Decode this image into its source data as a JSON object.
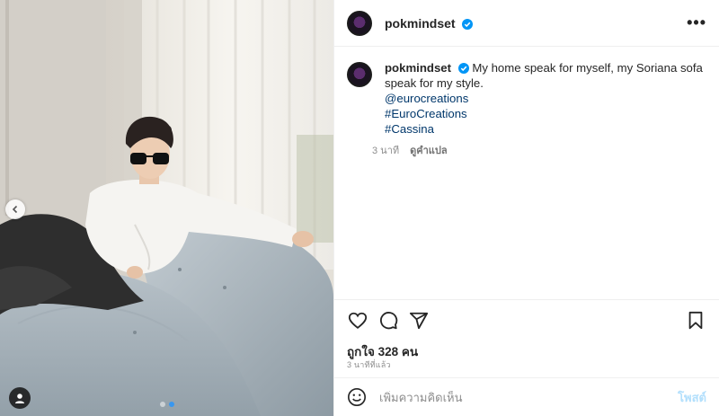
{
  "post": {
    "username": "pokmindset",
    "verified": true,
    "more_label": "•••",
    "caption": "My home speak for myself, my Soriana sofa speak for my style.",
    "links": [
      "@eurocreations",
      "#EuroCreations",
      "#Cassina"
    ],
    "time_ago": "3 นาที",
    "translate_label": "ดูคำแปล",
    "likes_label": "ถูกใจ 328 คน",
    "posted_ago": "3 นาทีที่แล้ว"
  },
  "comment": {
    "placeholder": "เพิ่มความคิดเห็น",
    "post_label": "โพสต์"
  },
  "carousel": {
    "current_index": 2,
    "total": 2
  },
  "icons": {
    "header_more": "more-horizontal-icon",
    "like": "heart-icon",
    "comment": "comment-bubble-icon",
    "share": "paper-plane-icon",
    "save": "bookmark-icon",
    "emoji": "smiley-icon",
    "prev": "chevron-left-icon",
    "tag": "user-tag-icon",
    "verified": "verified-badge-icon"
  },
  "colors": {
    "link": "#00376b",
    "verified": "#0095f6",
    "post_button_disabled": "#b2dffc",
    "carousel_active_dot": "#3897f0"
  }
}
